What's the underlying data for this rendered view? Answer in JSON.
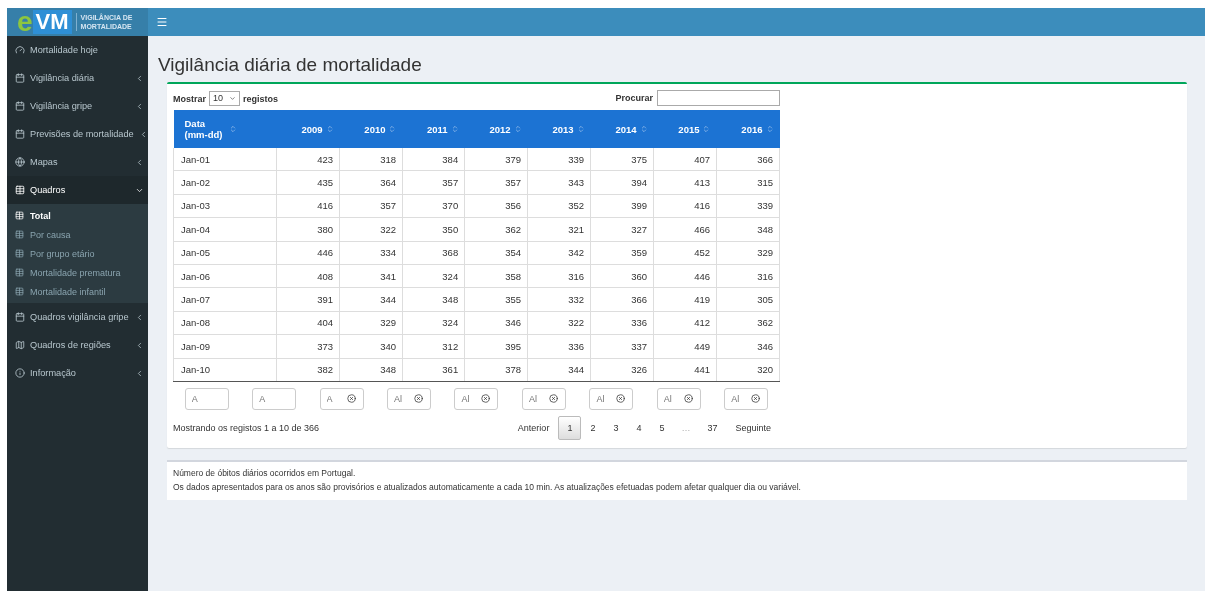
{
  "logo": {
    "mark_e": "e",
    "mark_vm": "VM",
    "line1": "VIGILÂNCIA",
    "line1_small": "DE",
    "line2": "MORTALIDADE"
  },
  "sidebar": {
    "items": [
      {
        "label": "Mortalidade hoje",
        "has_caret": false,
        "expanded": false
      },
      {
        "label": "Vigilância diária",
        "has_caret": true,
        "expanded": false
      },
      {
        "label": "Vigilância gripe",
        "has_caret": true,
        "expanded": false
      },
      {
        "label": "Previsões de mortalidade",
        "has_caret": true,
        "expanded": false
      },
      {
        "label": "Mapas",
        "has_caret": true,
        "expanded": false
      },
      {
        "label": "Quadros",
        "has_caret": true,
        "expanded": true,
        "children": [
          {
            "label": "Total",
            "selected": true
          },
          {
            "label": "Por causa",
            "selected": false
          },
          {
            "label": "Por grupo etário",
            "selected": false
          },
          {
            "label": "Mortalidade prematura",
            "selected": false
          },
          {
            "label": "Mortalidade infantil",
            "selected": false
          }
        ]
      },
      {
        "label": "Quadros vigilância gripe",
        "has_caret": true,
        "expanded": false
      },
      {
        "label": "Quadros de regiões",
        "has_caret": true,
        "expanded": false
      },
      {
        "label": "Informação",
        "has_caret": true,
        "expanded": false
      }
    ]
  },
  "page_title": "Vigilância diária de mortalidade",
  "table_controls": {
    "show_label": "Mostrar",
    "page_size": "10",
    "records_label": "registos",
    "search_label": "Procurar"
  },
  "table": {
    "columns": [
      "Data (mm-dd)",
      "2009",
      "2010",
      "2011",
      "2012",
      "2013",
      "2014",
      "2015",
      "2016"
    ],
    "rows": [
      [
        "Jan-01",
        "423",
        "318",
        "384",
        "379",
        "339",
        "375",
        "407",
        "366"
      ],
      [
        "Jan-02",
        "435",
        "364",
        "357",
        "357",
        "343",
        "394",
        "413",
        "315"
      ],
      [
        "Jan-03",
        "416",
        "357",
        "370",
        "356",
        "352",
        "399",
        "416",
        "339"
      ],
      [
        "Jan-04",
        "380",
        "322",
        "350",
        "362",
        "321",
        "327",
        "466",
        "348"
      ],
      [
        "Jan-05",
        "446",
        "334",
        "368",
        "354",
        "342",
        "359",
        "452",
        "329"
      ],
      [
        "Jan-06",
        "408",
        "341",
        "324",
        "358",
        "316",
        "360",
        "446",
        "316"
      ],
      [
        "Jan-07",
        "391",
        "344",
        "348",
        "355",
        "332",
        "366",
        "419",
        "305"
      ],
      [
        "Jan-08",
        "404",
        "329",
        "324",
        "346",
        "322",
        "336",
        "412",
        "362"
      ],
      [
        "Jan-09",
        "373",
        "340",
        "312",
        "395",
        "336",
        "337",
        "449",
        "346"
      ],
      [
        "Jan-10",
        "382",
        "348",
        "361",
        "378",
        "344",
        "326",
        "441",
        "320"
      ]
    ],
    "filters": [
      {
        "placeholder": "A",
        "clearable": false
      },
      {
        "placeholder": "A",
        "clearable": false
      },
      {
        "placeholder": "A",
        "clearable": true
      },
      {
        "placeholder": "Al",
        "clearable": true
      },
      {
        "placeholder": "Al",
        "clearable": true
      },
      {
        "placeholder": "Al",
        "clearable": true
      },
      {
        "placeholder": "Al",
        "clearable": true
      },
      {
        "placeholder": "Al",
        "clearable": true
      },
      {
        "placeholder": "Al",
        "clearable": true
      }
    ]
  },
  "table_info": "Mostrando os registos 1 a 10 de 366",
  "pagination": [
    {
      "label": "Anterior",
      "kind": "nav",
      "selected": false
    },
    {
      "label": "1",
      "kind": "page",
      "selected": true
    },
    {
      "label": "2",
      "kind": "page",
      "selected": false
    },
    {
      "label": "3",
      "kind": "page",
      "selected": false
    },
    {
      "label": "4",
      "kind": "page",
      "selected": false
    },
    {
      "label": "5",
      "kind": "page",
      "selected": false
    },
    {
      "label": "…",
      "kind": "ellipsis"
    },
    {
      "label": "37",
      "kind": "page",
      "selected": false
    },
    {
      "label": "Seguinte",
      "kind": "nav",
      "selected": false
    }
  ],
  "notes": [
    "Número de óbitos diários ocorridos em Portugal.",
    "Os dados apresentados para os anos são provisórios e atualizados automaticamente a cada 10 min. As atualizações efetuadas podem afetar qualquer dia ou variável."
  ]
}
